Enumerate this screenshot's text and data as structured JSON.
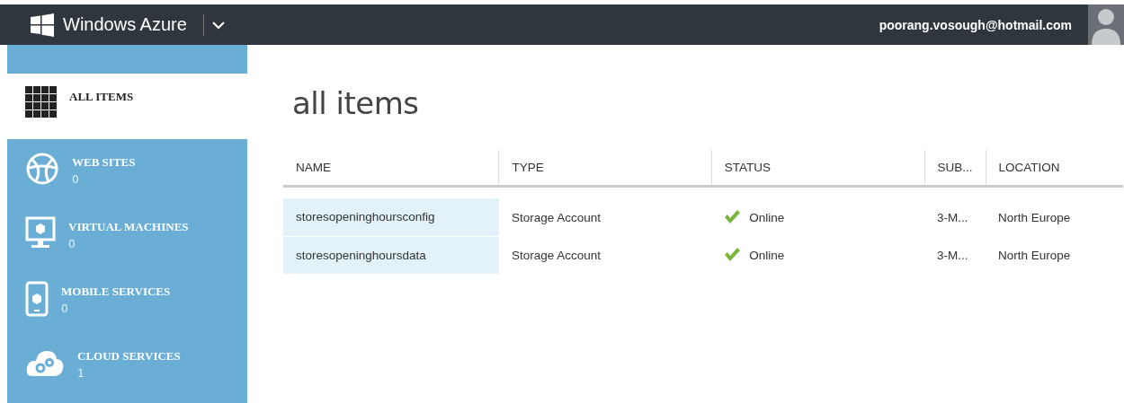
{
  "header": {
    "brand": "Windows Azure",
    "account": "poorang.vosough@hotmail.com"
  },
  "sidebar": {
    "items": [
      {
        "kind": "grid",
        "label": "ALL ITEMS",
        "selected": true
      },
      {
        "kind": "globe",
        "label": "WEB SITES",
        "count": "0",
        "selected": false
      },
      {
        "kind": "monitor",
        "label": "VIRTUAL MACHINES",
        "count": "0",
        "selected": false
      },
      {
        "kind": "phone",
        "label": "MOBILE SERVICES",
        "count": "0",
        "selected": false
      },
      {
        "kind": "cloud",
        "label": "CLOUD SERVICES",
        "count": "1",
        "selected": false
      }
    ]
  },
  "page": {
    "title": "all items"
  },
  "table": {
    "columns": [
      "NAME",
      "TYPE",
      "STATUS",
      "SUB...",
      "LOCATION"
    ],
    "rows": [
      {
        "name": "storesopeninghoursconfig",
        "type": "Storage Account",
        "status": "Online",
        "subscription": "3-M...",
        "location": "North Europe"
      },
      {
        "name": "storesopeninghoursdata",
        "type": "Storage Account",
        "status": "Online",
        "subscription": "3-M...",
        "location": "North Europe"
      }
    ]
  }
}
